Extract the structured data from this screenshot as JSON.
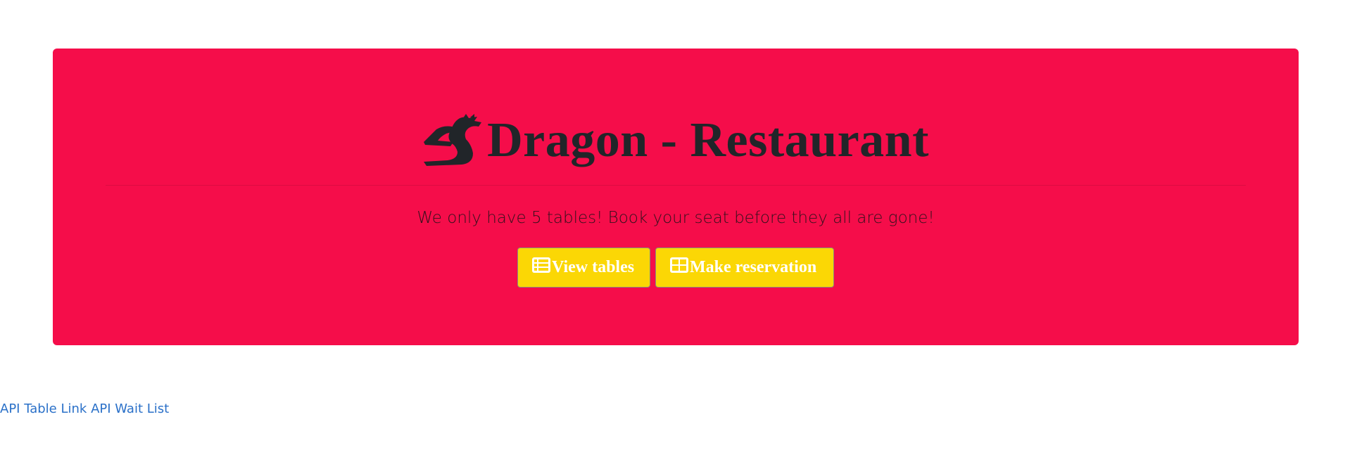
{
  "hero": {
    "title": "Dragon - Restaurant",
    "subtitle": "We only have 5 tables! Book your seat before they all are gone!",
    "background_color": "#f50d4a",
    "logo_icon": "dragon-icon"
  },
  "buttons": {
    "view_tables": {
      "label": "View tables",
      "icon": "list-icon"
    },
    "make_reservation": {
      "label": "Make reservation",
      "icon": "table-icon"
    },
    "color": "#fbd705"
  },
  "footer": {
    "links": [
      {
        "label": "API Table Link"
      },
      {
        "label": "API Wait List"
      }
    ],
    "link_color": "#2a70c8"
  }
}
